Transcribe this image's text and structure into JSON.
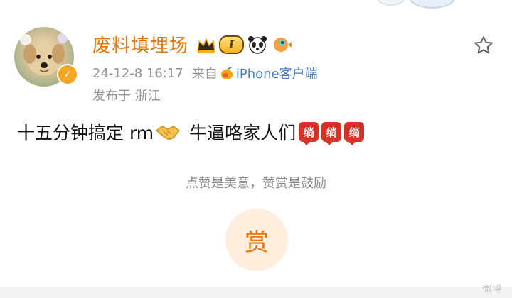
{
  "user": {
    "name": "废料填埋场",
    "level_badge": "I",
    "verified_icon": "verified-v-icon"
  },
  "post": {
    "time": "24-12-8 16:17",
    "source_prefix": "来自",
    "source_name": "iPhone客户端",
    "location": "发布于 浙江",
    "text_part1": "十五分钟搞定 rm",
    "text_part2": "牛逼咯家人们",
    "wan_glyph": "绱",
    "wan_count": 3
  },
  "reward": {
    "hint": "点赞是美意，赞赏是鼓励",
    "button_label": "赏"
  },
  "colors": {
    "username": "#e8750b",
    "meta": "#939393",
    "source": "#4a7cbf",
    "reward_bg": "#fdeedd",
    "badge_red": "#d93026"
  },
  "watermark": "微博"
}
